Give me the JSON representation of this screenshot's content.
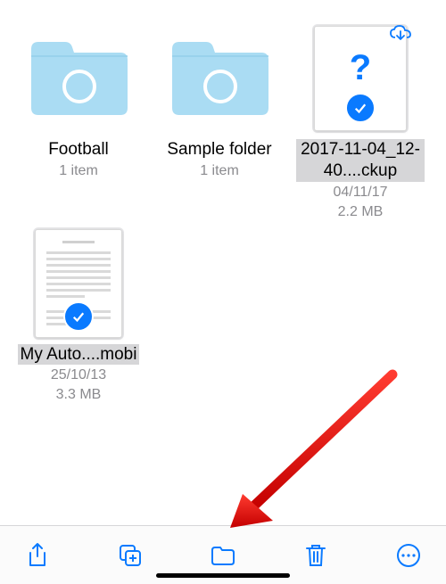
{
  "items": [
    {
      "name": "Football",
      "meta1": "1 item",
      "meta2": "",
      "type": "folder",
      "selected": false
    },
    {
      "name": "Sample folder",
      "meta1": "1 item",
      "meta2": "",
      "type": "folder",
      "selected": false
    },
    {
      "name": "2017-11-04_12-40....ckup",
      "meta1": "04/11/17",
      "meta2": "2.2 MB",
      "type": "unknown-file",
      "selected": true
    },
    {
      "name": "My Auto....mobi",
      "meta1": "25/10/13",
      "meta2": "3.3 MB",
      "type": "doc-file",
      "selected": true
    }
  ],
  "toolbar": {
    "share": "share",
    "duplicate": "duplicate",
    "move": "move",
    "delete": "delete",
    "more": "more"
  },
  "colors": {
    "accent": "#0a7aff",
    "folder": "#aadcf3"
  }
}
